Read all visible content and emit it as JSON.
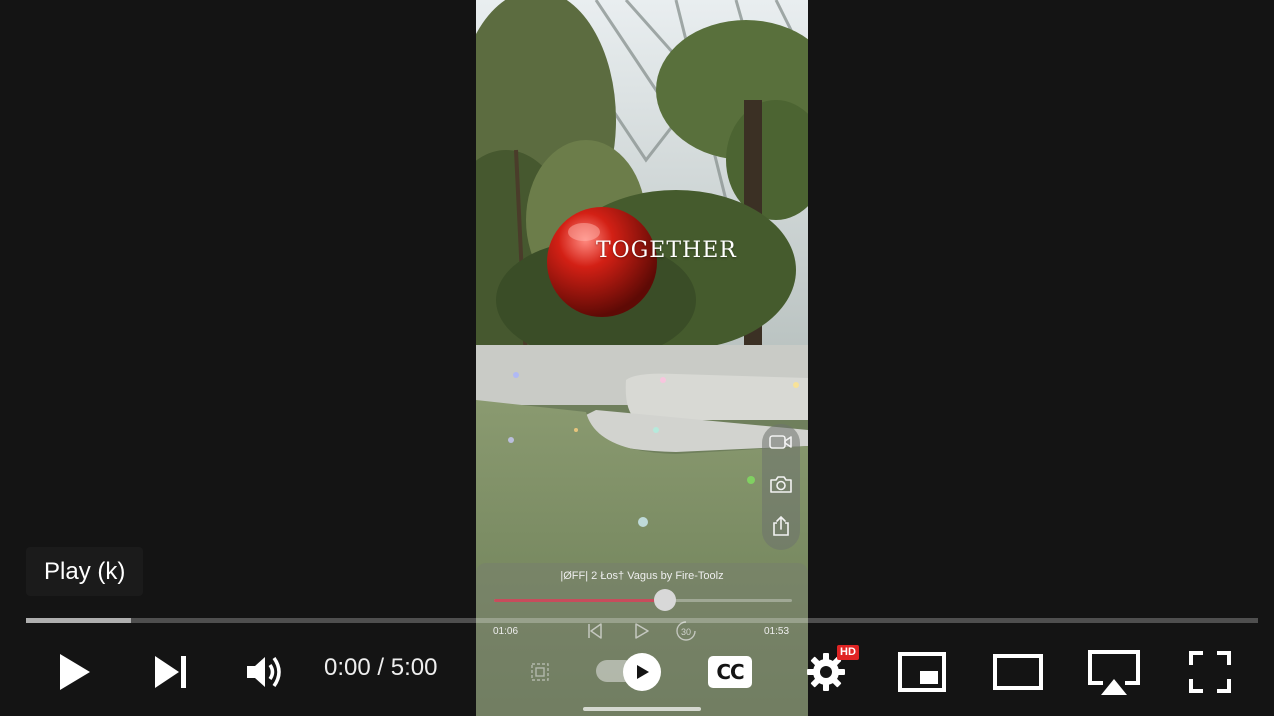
{
  "video": {
    "ornament_text": "TOGETHER",
    "music": {
      "title": "|ØFF| 2 Łos† Vagus by Fire-Toolz",
      "elapsed": "01:06",
      "duration": "01:53",
      "progress": 0.57
    },
    "camera_panel": {
      "buttons": [
        "video-camera-icon",
        "camera-icon",
        "share-icon"
      ]
    }
  },
  "tooltip": {
    "text": "Play (k)"
  },
  "progress": {
    "loaded_fraction": 0.085
  },
  "controls": {
    "time_current": "0:00",
    "time_separator": " / ",
    "time_total": "5:00",
    "time_display": "0:00 / 5:00",
    "cc_label": "CC",
    "hd_badge": "HD",
    "autoplay_on": true,
    "icons": [
      "play-icon",
      "next-icon",
      "volume-icon",
      "autoplay-toggle",
      "cc-icon",
      "settings-icon",
      "miniplayer-icon",
      "theater-icon",
      "airplay-icon",
      "fullscreen-icon"
    ]
  },
  "colors": {
    "background": "#141414",
    "progress_played": "#ff0000",
    "hd_badge": "#e02424",
    "music_progress": "#c84c5c"
  }
}
